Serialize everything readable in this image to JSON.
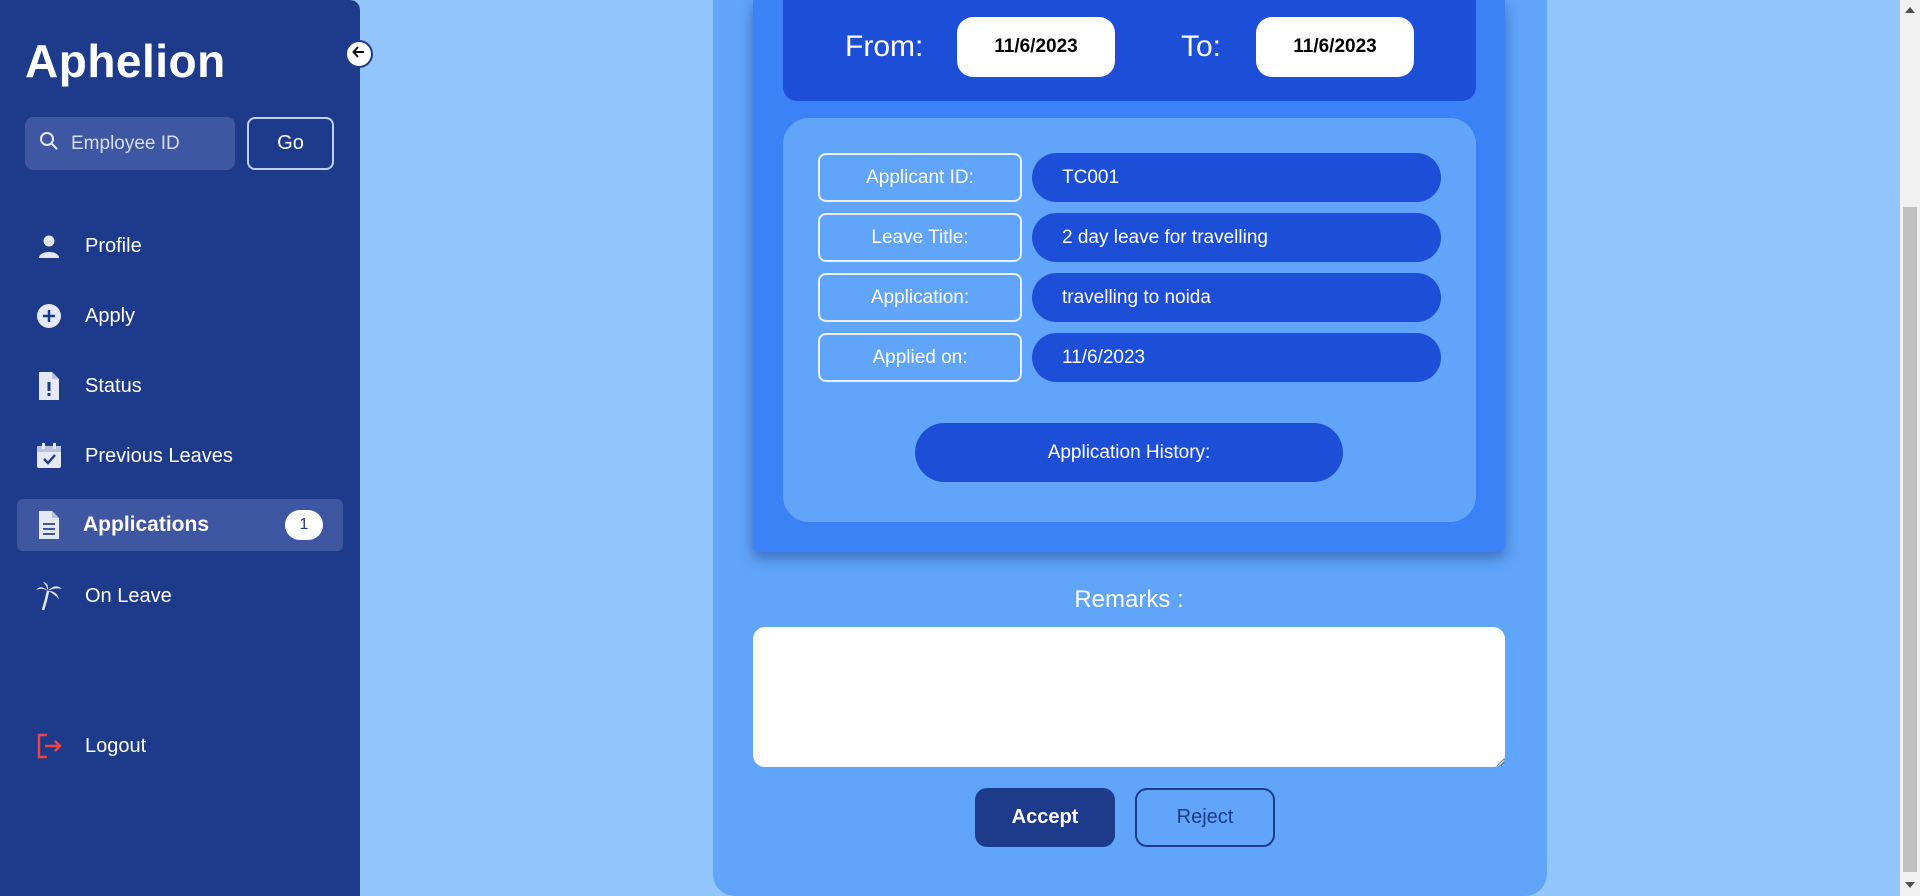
{
  "sidebar": {
    "brand": "Aphelion",
    "search": {
      "placeholder": "Employee ID",
      "icon": "search-icon"
    },
    "go_label": "Go",
    "items": [
      {
        "label": "Profile",
        "icon": "person-icon"
      },
      {
        "label": "Apply",
        "icon": "plus-circle-icon"
      },
      {
        "label": "Status",
        "icon": "file-alert-icon"
      },
      {
        "label": "Previous Leaves",
        "icon": "calendar-check-icon"
      },
      {
        "label": "Applications",
        "icon": "document-icon",
        "badge": "1",
        "active": true
      },
      {
        "label": "On Leave",
        "icon": "palm-tree-icon"
      }
    ],
    "logout": {
      "label": "Logout",
      "icon": "logout-icon"
    }
  },
  "application": {
    "from_label": "From:",
    "from_date": "11/6/2023",
    "to_label": "To:",
    "to_date": "11/6/2023",
    "fields": [
      {
        "label": "Applicant ID:",
        "value": "TC001"
      },
      {
        "label": "Leave Title:",
        "value": "2 day leave for travelling"
      },
      {
        "label": "Application:",
        "value": "travelling to noida"
      },
      {
        "label": "Applied on:",
        "value": "11/6/2023"
      }
    ],
    "history_label": "Application History:",
    "remarks_label": "Remarks :",
    "remarks_value": "",
    "accept_label": "Accept",
    "reject_label": "Reject"
  },
  "colors": {
    "sidebar_bg": "#1e3a8a",
    "page_bg": "#93c5fd",
    "panel_bg": "#60a5fa",
    "card_bg": "#3b82f6",
    "accent": "#1d4ed8",
    "logout_icon": "#ef4444"
  }
}
